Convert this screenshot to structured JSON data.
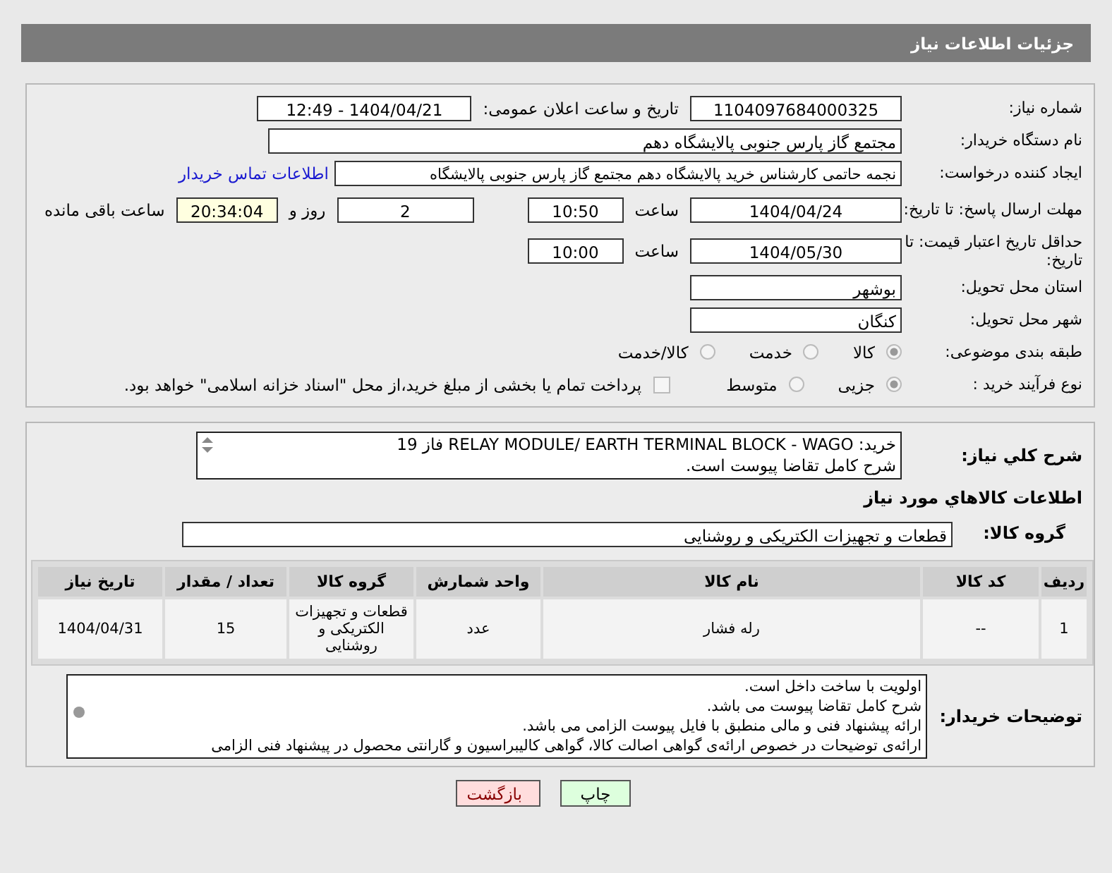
{
  "header": {
    "title": "جزئیات اطلاعات نیاز"
  },
  "need_number": {
    "label": "شماره نیاز:",
    "value": "1104097684000325"
  },
  "announce": {
    "label": "تاریخ و ساعت اعلان عمومی:",
    "value": "1404/04/21 - 12:49"
  },
  "buyer_org": {
    "label": "نام دستگاه خریدار:",
    "value": "مجتمع گاز پارس جنوبی  پالایشگاه دهم"
  },
  "requester": {
    "label": "ایجاد کننده درخواست:",
    "value": "نجمه حاتمی کارشناس خرید پالایشگاه دهم  مجتمع گاز پارس جنوبی  پالایشگاه",
    "link": "اطلاعات تماس خریدار"
  },
  "reply_deadline": {
    "label": "مهلت ارسال پاسخ: تا تاریخ:",
    "date": "1404/04/24",
    "time_label": "ساعت",
    "time": "10:50",
    "days": "2",
    "days_label": "روز و",
    "remaining": "20:34:04",
    "remaining_label": "ساعت باقی مانده"
  },
  "price_validity": {
    "label": "حداقل تاریخ اعتبار قیمت: تا تاریخ:",
    "date": "1404/05/30",
    "time_label": "ساعت",
    "time": "10:00"
  },
  "province": {
    "label": "استان محل تحویل:",
    "value": "بوشهر"
  },
  "city": {
    "label": "شهر محل تحویل:",
    "value": "کنگان"
  },
  "category": {
    "label": "طبقه بندی موضوعی:",
    "options": [
      {
        "label": "کالا",
        "selected": true
      },
      {
        "label": "خدمت",
        "selected": false
      },
      {
        "label": "کالا/خدمت",
        "selected": false
      }
    ]
  },
  "process": {
    "label": "نوع فرآیند خرید :",
    "options": [
      {
        "label": "جزیی",
        "selected": true
      },
      {
        "label": "متوسط",
        "selected": false
      }
    ],
    "payment": {
      "label": "پرداخت تمام یا بخشی از مبلغ خرید،از محل \"اسناد خزانه اسلامی\" خواهد بود.",
      "checked": false
    }
  },
  "description": {
    "label": "شرح کلي نياز:",
    "lines": [
      "خرید: RELAY MODULE/ EARTH TERMINAL BLOCK - WAGO فاز 19",
      "شرح کامل تقاضا پیوست است."
    ]
  },
  "goods_title": "اطلاعات کالاهاي مورد نياز",
  "goods_group": {
    "label": "گروه کالا:",
    "value": "قطعات و تجهیزات الکتریکی و روشنایی"
  },
  "table": {
    "columns": [
      "ردیف",
      "کد کالا",
      "نام کالا",
      "واحد شمارش",
      "گروه کالا",
      "تعداد / مقدار",
      "تاریخ نیاز"
    ],
    "rows": [
      [
        "1",
        "--",
        "رله فشار",
        "عدد",
        "قطعات و تجهیزات الکتریکی و روشنایی",
        "15",
        "1404/04/31"
      ]
    ]
  },
  "buyer_notes": {
    "label": "توضیحات خریدار:",
    "lines": [
      "اولویت با ساخت داخل است.",
      "شرح کامل تقاضا پیوست می باشد.",
      "ارائه پیشنهاد فنی و مالی منطبق با فایل پیوست الزامی می باشد.",
      "ارائه‌ی توضیحات در خصوص ارائه‌ی گواهی اصالت کالا، گواهی کالیبراسیون و گارانتی محصول در پیشنهاد فنی الزامی"
    ]
  },
  "buttons": [
    {
      "label": "چاپ",
      "kind": "print"
    },
    {
      "label": "بازگشت",
      "kind": "back"
    }
  ]
}
